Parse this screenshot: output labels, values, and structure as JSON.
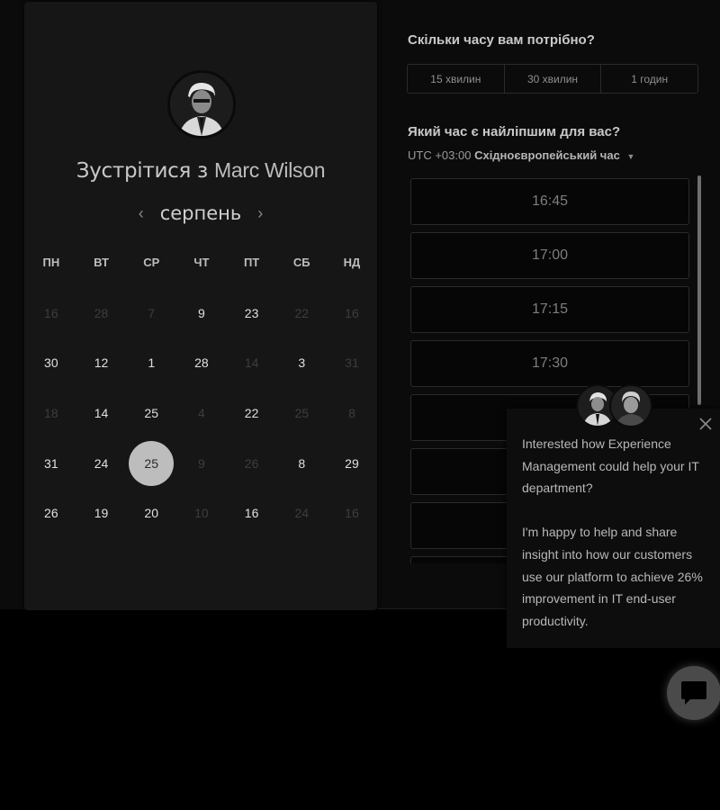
{
  "calendar": {
    "title_prefix": "Зустрітися з",
    "host_name": "Marc Wilson",
    "month": "серпень",
    "prev_arrow": "‹",
    "next_arrow": "›",
    "weekdays": [
      "ПН",
      "ВТ",
      "СР",
      "ЧТ",
      "ПТ",
      "СБ",
      "НД"
    ],
    "weeks": [
      [
        {
          "d": "16",
          "on": false
        },
        {
          "d": "28",
          "on": false
        },
        {
          "d": "7",
          "on": false
        },
        {
          "d": "9",
          "on": true
        },
        {
          "d": "23",
          "on": true
        },
        {
          "d": "22",
          "on": false
        },
        {
          "d": "16",
          "on": false
        }
      ],
      [
        {
          "d": "30",
          "on": true
        },
        {
          "d": "12",
          "on": true
        },
        {
          "d": "1",
          "on": true
        },
        {
          "d": "28",
          "on": true
        },
        {
          "d": "14",
          "on": false
        },
        {
          "d": "3",
          "on": true
        },
        {
          "d": "31",
          "on": false
        }
      ],
      [
        {
          "d": "18",
          "on": false
        },
        {
          "d": "14",
          "on": true
        },
        {
          "d": "25",
          "on": true
        },
        {
          "d": "4",
          "on": false
        },
        {
          "d": "22",
          "on": true
        },
        {
          "d": "25",
          "on": false
        },
        {
          "d": "8",
          "on": false
        }
      ],
      [
        {
          "d": "31",
          "on": true
        },
        {
          "d": "24",
          "on": true
        },
        {
          "d": "25",
          "on": true,
          "sel": true
        },
        {
          "d": "9",
          "on": false
        },
        {
          "d": "26",
          "on": false
        },
        {
          "d": "8",
          "on": true
        },
        {
          "d": "29",
          "on": true
        }
      ],
      [
        {
          "d": "26",
          "on": true
        },
        {
          "d": "19",
          "on": true
        },
        {
          "d": "20",
          "on": true
        },
        {
          "d": "10",
          "on": false
        },
        {
          "d": "16",
          "on": true
        },
        {
          "d": "24",
          "on": false
        },
        {
          "d": "16",
          "on": false
        }
      ]
    ]
  },
  "duration": {
    "question": "Скільки часу вам потрібно?",
    "options": [
      "15 хвилин",
      "30 хвилин",
      "1 годин"
    ]
  },
  "time": {
    "question": "Який час є найліпшим для вас?",
    "tz_offset": "UTC +03:00",
    "tz_name": "Східноєвропейський час",
    "slots": [
      "16:45",
      "17:00",
      "17:15",
      "17:30"
    ]
  },
  "chat": {
    "paragraph1": "Interested how Experience Management could help your IT department?",
    "paragraph2": "I'm happy to help and share insight into how our customers use our platform to achieve 26% improvement in IT end-user productivity."
  },
  "colors": {
    "background": "#000000",
    "card": "#161616",
    "selected_day": "#bdbdbd",
    "text_primary": "#e0e0e0",
    "text_disabled": "#3d3d3d"
  }
}
